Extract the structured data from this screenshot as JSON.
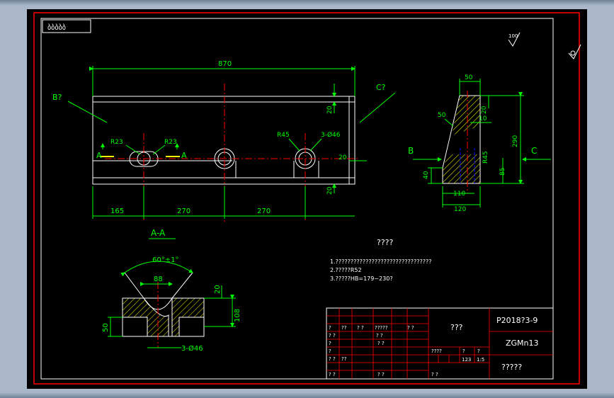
{
  "colors": {
    "background": "#000000",
    "frame_outer": "#FF0000",
    "frame_inner": "#FFFFFF",
    "outline": "#FFFFFF",
    "dimension": "#00FF00",
    "centerline": "#FF0000",
    "hatch": "#FFFF00",
    "hidden": "#0000FF",
    "note_text": "#FFFFFF",
    "titleblock_lines": "#FF0000",
    "titleblock_text": "#FFFFFF"
  },
  "top_left_box": {
    "text": "ბბბბბ"
  },
  "roughness_top": {
    "value": "100"
  },
  "front_view": {
    "overall_length": "870",
    "label_b": "B?",
    "label_c": "C?",
    "r_left": "R23",
    "r_right": "R23",
    "r45": "R45",
    "holes": "3-Ø46",
    "section_left": "A",
    "section_right": "A",
    "dim_20_top": "20",
    "dim_20_mid": "20",
    "dim_20_bottom": "20",
    "dim_165": "165",
    "dim_270_a": "270",
    "dim_270_b": "270"
  },
  "side_view": {
    "dim_50_top": "50",
    "dim_50_slope": "50",
    "dim_10": "10",
    "dim_20": "20",
    "dim_290": "290",
    "dim_r45": "R45",
    "dim_85": "85",
    "dim_40": "40",
    "dim_110": "110",
    "dim_120": "120",
    "label_b": "B",
    "label_c": "C"
  },
  "section_view": {
    "title": "A-A",
    "angle": "60°±1°",
    "width": "88",
    "dim_20": "20",
    "dim_108": "108",
    "dim_50": "50",
    "holes": "3-Ø46"
  },
  "notes": {
    "heading": "????",
    "line1": "1.????????????????????????????????",
    "line2": "2.?????R52",
    "line3": "3.?????HB=179~230?"
  },
  "title_block": {
    "drawing_no": "P2018?3-9",
    "material": "ZGMn13",
    "part_name": "???",
    "company": "?????",
    "scale": "1:5",
    "sheet": "123",
    "grid_cells": [
      "?",
      "??",
      "? ?",
      "?????",
      "? ?",
      "? ?",
      "? ?",
      "?",
      "? ?",
      "?",
      "????",
      "?",
      "?",
      "? ?",
      "??",
      "? ?",
      "? ?",
      "? ?"
    ]
  }
}
